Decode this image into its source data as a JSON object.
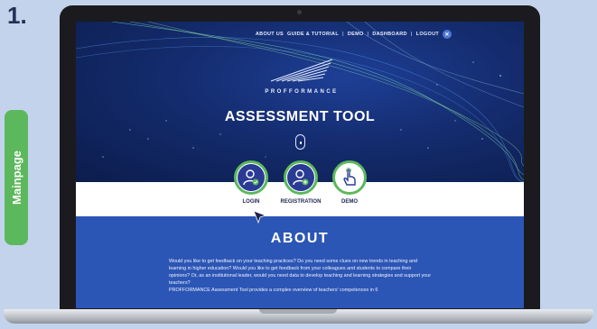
{
  "step_number": "1.",
  "side_tab": {
    "label": "Mainpage"
  },
  "nav": {
    "items": [
      "ABOUT US",
      "GUIDE & TUTORIAL",
      "DEMO",
      "DASHBOARD",
      "LOGOUT"
    ],
    "separator": "|",
    "user_icon_glyph": "✕"
  },
  "hero": {
    "brand": "PROFFORMANCE",
    "title": "ASSESSMENT TOOL"
  },
  "actions": [
    {
      "label": "LOGIN",
      "icon": "user-check-icon"
    },
    {
      "label": "REGISTRATION",
      "icon": "user-add-icon"
    },
    {
      "label": "DEMO",
      "icon": "hand-pointer-icon"
    }
  ],
  "about": {
    "title": "ABOUT",
    "paragraphs": [
      "Would you like to get feedback on your teaching practices? Do you need some clues on new trends in teaching and learning in higher education? Would you like to get feedback from your colleagues and students to compare their opinions? Or, as an institutional leader, would you need data to develop teaching and learning strategies and support your teachers?",
      "PROFFORMANCE Assessment Tool provides a complex overview of teachers' competences in 6"
    ]
  },
  "colors": {
    "page_background": "#c3d3ec",
    "accent_green": "#5cb85c",
    "navy": "#2a3b96",
    "hero_dark": "#0c1c4c",
    "about_blue": "#2c56b5"
  }
}
